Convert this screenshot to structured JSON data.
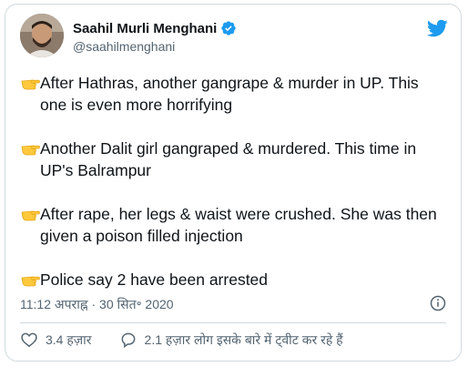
{
  "author": {
    "name": "Saahil Murli Menghani",
    "handle": "@saahilmenghani",
    "verified": true
  },
  "tweet": {
    "paragraphs": [
      {
        "icon": "pointing-hand-emoji",
        "text": "After Hathras, another gangrape & murder in UP. This one is even more horrifying"
      },
      {
        "icon": "pointing-hand-emoji",
        "text": "Another Dalit girl gangraped & murdered. This time in UP's Balrampur"
      },
      {
        "icon": "pointing-hand-emoji",
        "text": "After rape, her legs & waist were crushed. She was then given a poison filled injection"
      },
      {
        "icon": "pointing-hand-emoji",
        "text": "Police say 2 have been arrested"
      }
    ],
    "timestamp": "11:12 अपराह्न · 30 सित॰ 2020"
  },
  "actions": {
    "likes": "3.4 हज़ार",
    "replies": "2.1 हज़ार लोग इसके बारे में ट्वीट कर रहे हैं"
  },
  "colors": {
    "brand": "#1d9bf0",
    "text": "#0f1419",
    "muted": "#536471",
    "border": "#cfd9de",
    "hand": "#ffc83d"
  }
}
